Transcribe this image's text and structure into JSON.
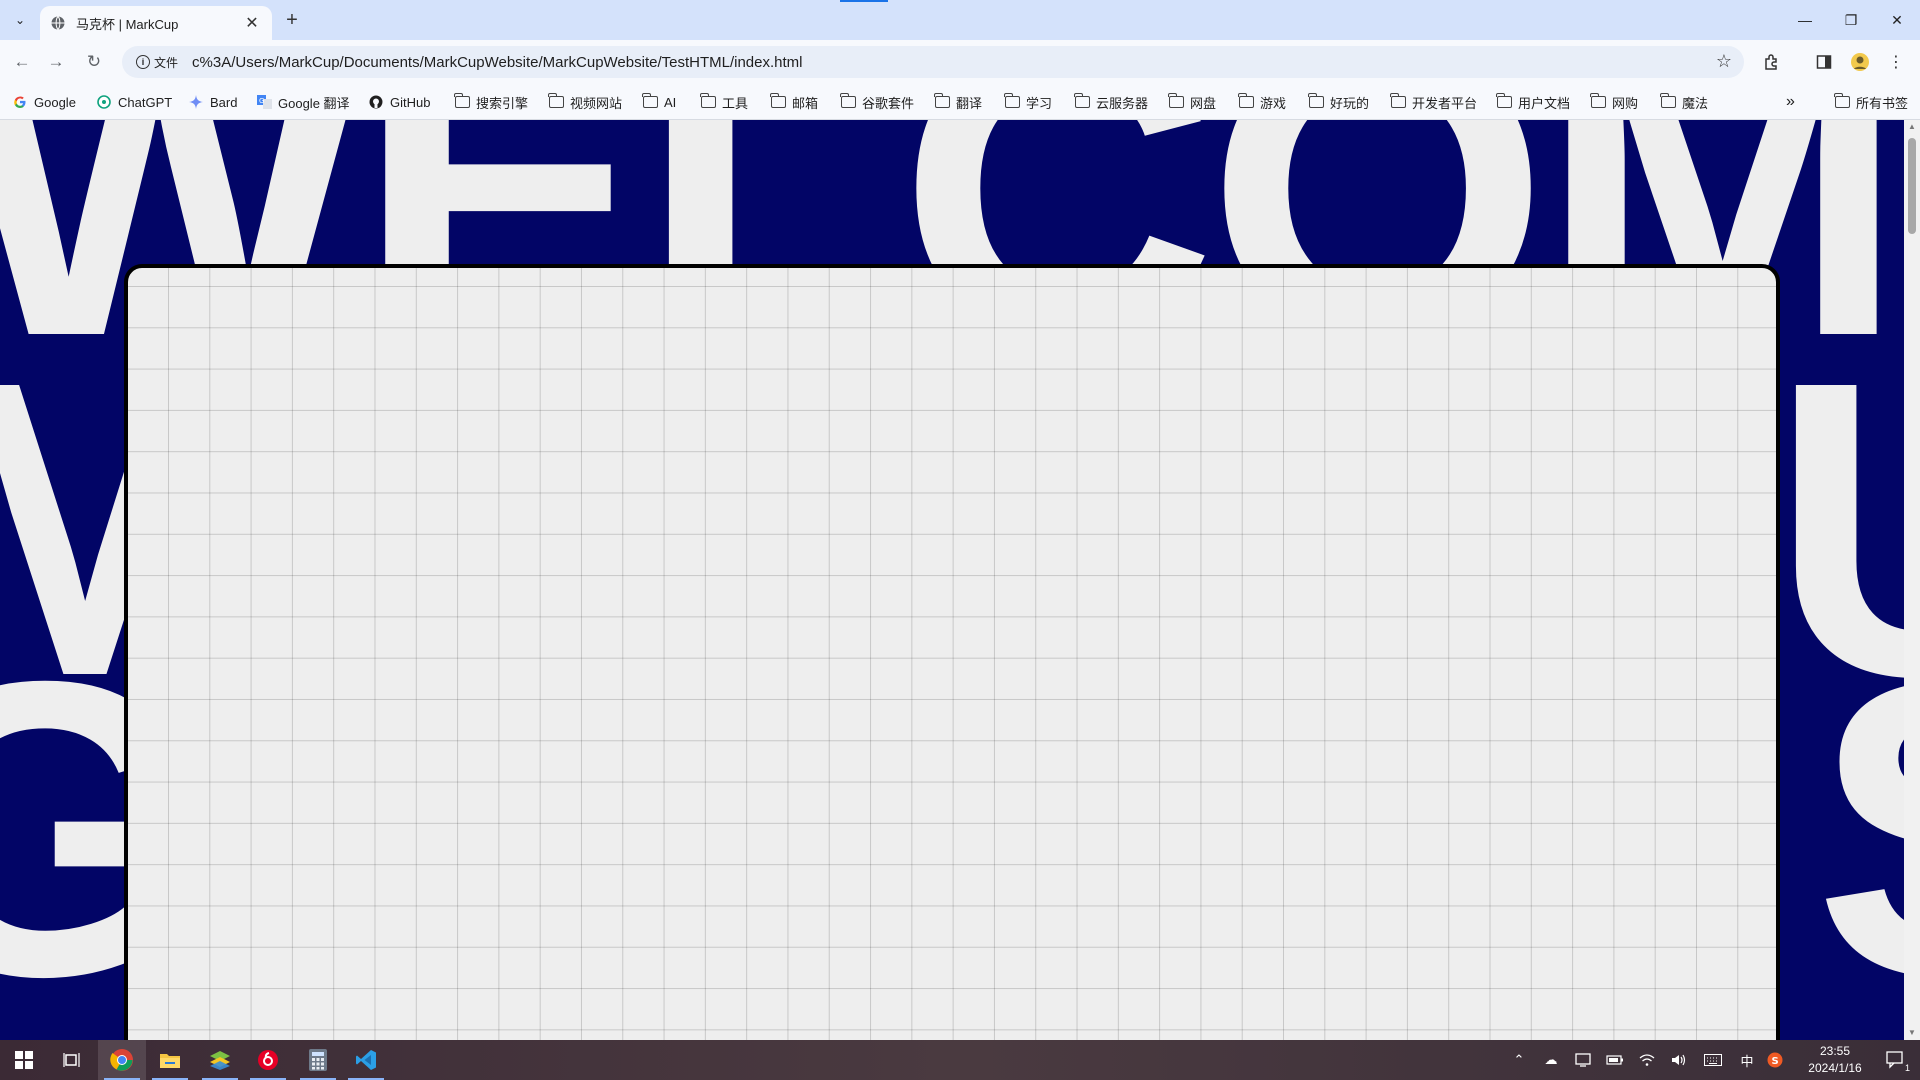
{
  "browser": {
    "tab": {
      "title": "马克杯 | MarkCup",
      "close": "✕"
    },
    "new_tab": "+",
    "window_controls": {
      "minimize": "—",
      "restore": "❐",
      "close": "✕"
    },
    "site_info_label": "文件",
    "url": "c%3A/Users/MarkCup/Documents/MarkCupWebsite/MarkCupWebsite/TestHTML/index.html",
    "bookmarks": [
      {
        "label": "Google",
        "icon": "google-icon"
      },
      {
        "label": "ChatGPT",
        "icon": "chatgpt-icon"
      },
      {
        "label": "Bard",
        "icon": "bard-icon"
      },
      {
        "label": "Google 翻译",
        "icon": "translate-icon"
      },
      {
        "label": "GitHub",
        "icon": "github-icon"
      },
      {
        "label": "搜索引擎",
        "icon": "folder-icon"
      },
      {
        "label": "视频网站",
        "icon": "folder-icon"
      },
      {
        "label": "AI",
        "icon": "folder-icon"
      },
      {
        "label": "工具",
        "icon": "folder-icon"
      },
      {
        "label": "邮箱",
        "icon": "folder-icon"
      },
      {
        "label": "谷歌套件",
        "icon": "folder-icon"
      },
      {
        "label": "翻译",
        "icon": "folder-icon"
      },
      {
        "label": "学习",
        "icon": "folder-icon"
      },
      {
        "label": "云服务器",
        "icon": "folder-icon"
      },
      {
        "label": "网盘",
        "icon": "folder-icon"
      },
      {
        "label": "游戏",
        "icon": "folder-icon"
      },
      {
        "label": "好玩的",
        "icon": "folder-icon"
      },
      {
        "label": "开发者平台",
        "icon": "folder-icon"
      },
      {
        "label": "用户文档",
        "icon": "folder-icon"
      },
      {
        "label": "网购",
        "icon": "folder-icon"
      },
      {
        "label": "魔法",
        "icon": "folder-icon"
      }
    ],
    "bookmarks_overflow": "»",
    "all_bookmarks": "所有书签"
  },
  "page": {
    "background_word": "WELCOME",
    "row2_left": "M",
    "row2_right": "U",
    "row3_left": "G",
    "row3_right": "S",
    "colors": {
      "background": "#020566",
      "text": "#eeeeee",
      "card": "#eeeeee",
      "card_border": "#000000"
    }
  },
  "taskbar": {
    "apps": [
      "windows-start-icon",
      "task-view-icon",
      "chrome-icon",
      "file-explorer-icon",
      "bluestacks-icon",
      "netease-music-icon",
      "calculator-icon",
      "vscode-icon"
    ],
    "tray": {
      "ime": "中"
    },
    "time": "23:55",
    "date": "2024/1/16",
    "notification_count": "1"
  }
}
